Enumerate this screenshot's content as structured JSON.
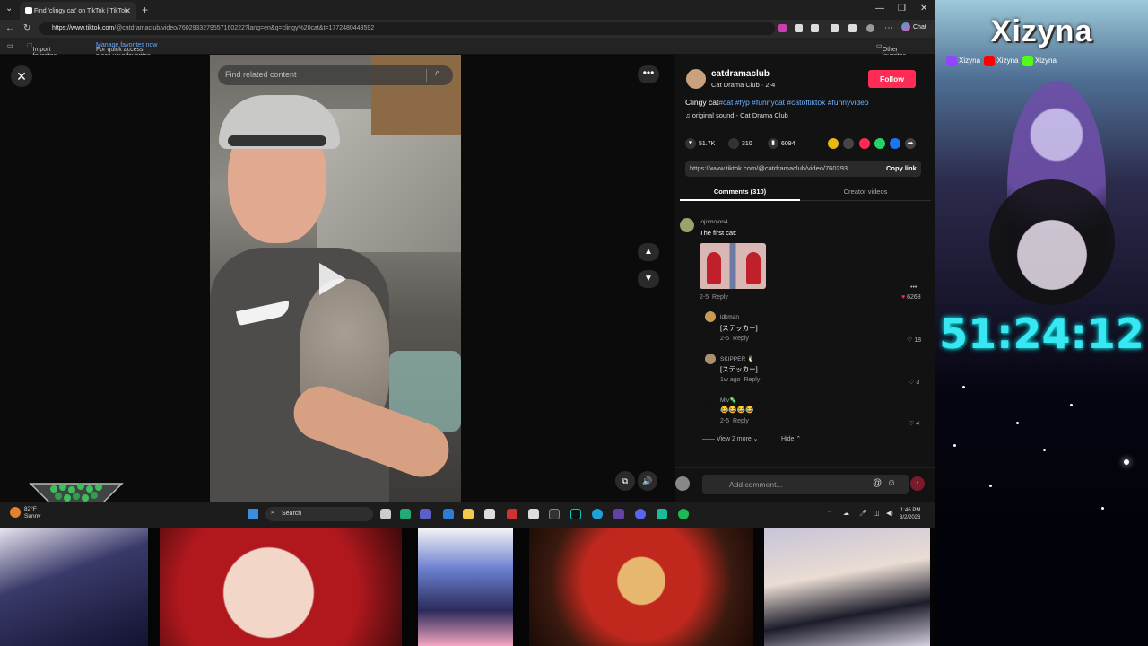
{
  "browser": {
    "tab_title": "Find 'clingy cat' on TikTok | TikTok",
    "url_domain": "https://www.tiktok.com",
    "url_path": "/@catdramaclub/video/7602933279557160222?lang=en&q=clingy%20cat&t=1772480443592",
    "chat_label": "Chat",
    "favorites": {
      "import_label": "Import favorites",
      "hint": "For quick access, place your favorites here on the favorites bar.",
      "manage_link": "Manage favorites now",
      "other_label": "Other favorites"
    }
  },
  "player": {
    "search_placeholder": "Find related content"
  },
  "post": {
    "author": "catdramaclub",
    "author_sub": "Cat Drama Club · 2-4",
    "follow_label": "Follow",
    "desc_text": "Clingy cat",
    "hashtags": "#cat #fyp #funnycat #catoftiktok #funnyvideo",
    "sound": "original sound - Cat Drama Club",
    "likes": "51.7K",
    "comments_count": "310",
    "saves": "6094",
    "link": "https://www.tiktok.com/@catdramaclub/video/760293...",
    "copy_link_label": "Copy link",
    "tab_comments": "Comments (310)",
    "tab_creator": "Creator videos"
  },
  "comments": [
    {
      "user": "jojomojon4",
      "text": "The first cat:",
      "date": "2-5",
      "reply": "Reply",
      "likes": "6268"
    },
    {
      "user": "ldkman",
      "text": "[ステッカー]",
      "date": "2-5",
      "reply": "Reply",
      "likes": "18"
    },
    {
      "user": "SKIPPER 🐧",
      "text": "[ステッカー]",
      "date": "1w ago",
      "reply": "Reply",
      "likes": "3"
    },
    {
      "user": "Mlv🦠",
      "text": "😂😂😂😂",
      "date": "2-5",
      "reply": "Reply",
      "likes": "4"
    }
  ],
  "comments_ui": {
    "view_more": "View 2 more",
    "hide": "Hide",
    "input_placeholder": "Add comment..."
  },
  "taskbar": {
    "temp": "82°F",
    "weather": "Sunny",
    "search_label": "Search",
    "time": "1:46 PM",
    "date": "3/2/2026"
  },
  "overlay": {
    "streamer": "Xizyna",
    "socials": [
      "Xizyna",
      "Xizyna",
      "Xizyna"
    ],
    "timer": "51:24:12"
  },
  "colors": {
    "accent_follow": "#fe2c55",
    "hashtag": "#6ab4ff",
    "timer": "#38e7f2"
  }
}
